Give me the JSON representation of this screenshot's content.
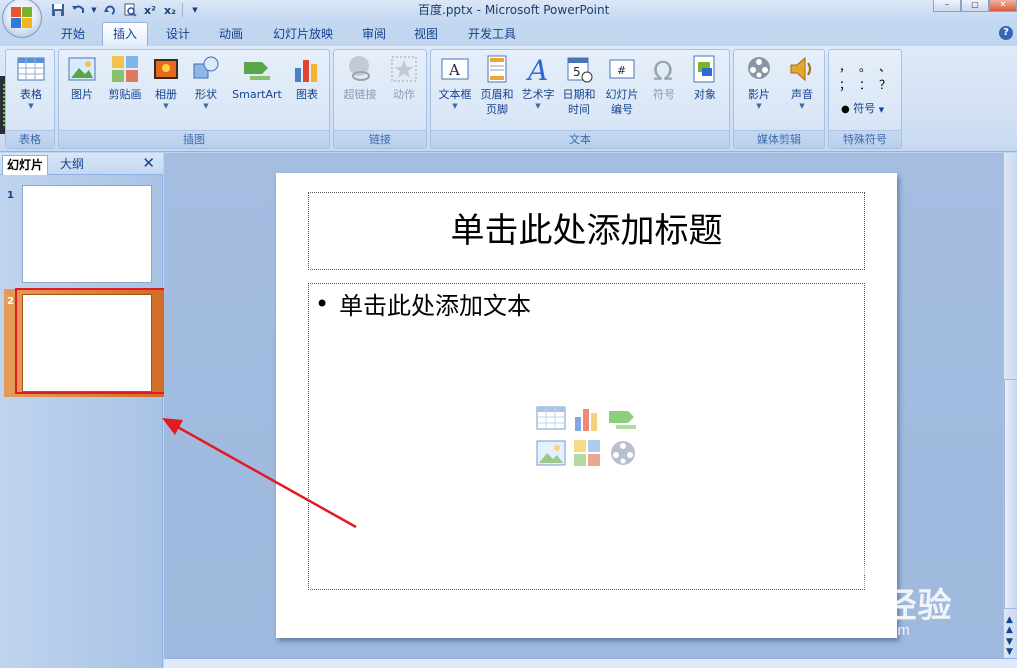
{
  "window": {
    "title": "百度.pptx - Microsoft PowerPoint"
  },
  "qat": [
    "save-icon",
    "undo-icon",
    "redo-icon",
    "print-preview-icon",
    "superscript-icon",
    "subscript-icon"
  ],
  "qat_labels": {
    "superscript": "x²",
    "subscript": "x₂"
  },
  "tabs": [
    {
      "label": "开始"
    },
    {
      "label": "插入",
      "active": true
    },
    {
      "label": "设计"
    },
    {
      "label": "动画"
    },
    {
      "label": "幻灯片放映"
    },
    {
      "label": "审阅"
    },
    {
      "label": "视图"
    },
    {
      "label": "开发工具"
    }
  ],
  "ribbon": {
    "groups": {
      "table": {
        "label": "表格",
        "buttons": {
          "table": "表格"
        }
      },
      "illustrations": {
        "label": "插图",
        "buttons": {
          "picture": "图片",
          "clipart": "剪贴画",
          "album": "相册",
          "shapes": "形状",
          "smartart": "SmartArt",
          "chart": "图表"
        }
      },
      "links": {
        "label": "链接",
        "buttons": {
          "hyperlink": "超链接",
          "action": "动作"
        }
      },
      "text": {
        "label": "文本",
        "buttons": {
          "textbox": "文本框",
          "header1": "页眉和",
          "header2": "页脚",
          "wordart": "艺术字",
          "datetime1": "日期和",
          "datetime2": "时间",
          "slidenum1": "幻灯片",
          "slidenum2": "编号",
          "symbol": "符号",
          "object": "对象"
        }
      },
      "media": {
        "label": "媒体剪辑",
        "buttons": {
          "movie": "影片",
          "sound": "声音"
        }
      },
      "special": {
        "label": "特殊符号",
        "buttons": {
          "symbol": "符号"
        },
        "glyphs": [
          "，",
          "。",
          "、",
          "；",
          "：",
          "？"
        ]
      }
    }
  },
  "left_pane": {
    "tabs": [
      "幻灯片",
      "大纲"
    ],
    "slides": [
      {
        "number": "1"
      },
      {
        "number": "2",
        "selected": true
      }
    ]
  },
  "slide": {
    "title_placeholder": "单击此处添加标题",
    "body_bullet": "•",
    "body_placeholder": "单击此处添加文本"
  },
  "watermark": {
    "main": "Baidu经验",
    "sub": "jingyan.baidu.com"
  },
  "colors": {
    "annotation_red": "#e21b23",
    "selection_orange": "#d06c25"
  }
}
